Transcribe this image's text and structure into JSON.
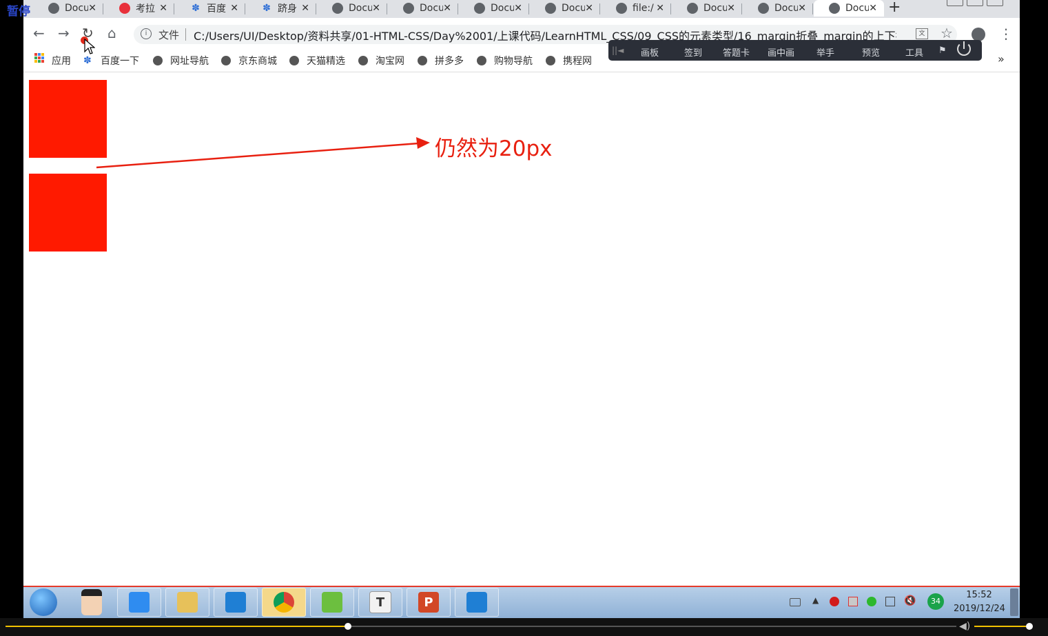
{
  "recorder": {
    "pause_label": "暂停"
  },
  "browser": {
    "tabs": [
      {
        "title": "Docu",
        "icon": "globe-icon"
      },
      {
        "title": "考拉",
        "icon": "kaola-icon"
      },
      {
        "title": "百度",
        "icon": "baidu-paw-icon"
      },
      {
        "title": "跻身",
        "icon": "baidu-paw-icon"
      },
      {
        "title": "Docu",
        "icon": "globe-icon"
      },
      {
        "title": "Docu",
        "icon": "globe-icon"
      },
      {
        "title": "Docu",
        "icon": "globe-icon"
      },
      {
        "title": "Docu",
        "icon": "globe-icon"
      },
      {
        "title": "file:/",
        "icon": "globe-icon"
      },
      {
        "title": "Docu",
        "icon": "globe-icon"
      },
      {
        "title": "Docu",
        "icon": "globe-icon"
      },
      {
        "title": "Docu",
        "icon": "globe-icon",
        "active": true
      }
    ],
    "new_tab_label": "+",
    "address": {
      "scheme_label": "文件",
      "url": "C:/Users/UI/Desktop/资料共享/01-HTML-CSS/Day%2001/上课代码/LearnHTML_CSS/09_CSS的元素类型/16_margin折叠_margin的上下折..."
    },
    "bookmarks": {
      "apps_label": "应用",
      "items": [
        {
          "label": "百度一下",
          "icon": "baidu-paw-icon"
        },
        {
          "label": "网址导航",
          "icon": "globe-icon"
        },
        {
          "label": "京东商城",
          "icon": "globe-icon"
        },
        {
          "label": "天猫精选",
          "icon": "globe-icon"
        },
        {
          "label": "淘宝网",
          "icon": "globe-icon"
        },
        {
          "label": "拼多多",
          "icon": "globe-icon"
        },
        {
          "label": "购物导航",
          "icon": "globe-icon"
        },
        {
          "label": "携程网",
          "icon": "globe-icon"
        }
      ],
      "more_label": "»"
    }
  },
  "classroom_toolbar": {
    "items": [
      "画板",
      "签到",
      "答题卡",
      "画中画",
      "举手",
      "预览",
      "工具"
    ]
  },
  "page": {
    "annotation_text": "仍然为20px",
    "box_color": "#ff1a00",
    "annotation_color": "#e82010"
  },
  "taskbar": {
    "apps": [
      {
        "name": "tencent-classroom-icon",
        "label": ""
      },
      {
        "name": "file-explorer-icon",
        "label": ""
      },
      {
        "name": "vscode-icon",
        "label": ""
      },
      {
        "name": "chrome-icon",
        "label": "",
        "active": true
      },
      {
        "name": "notepad-icon",
        "label": ""
      },
      {
        "name": "typora-icon",
        "label": "T"
      },
      {
        "name": "powerpoint-icon",
        "label": "P"
      },
      {
        "name": "vscode-icon",
        "label": ""
      }
    ],
    "battery_badge": "34",
    "clock_time": "15:52",
    "clock_date": "2019/12/24"
  },
  "player": {
    "progress": 0.36,
    "volume": 0.92
  }
}
